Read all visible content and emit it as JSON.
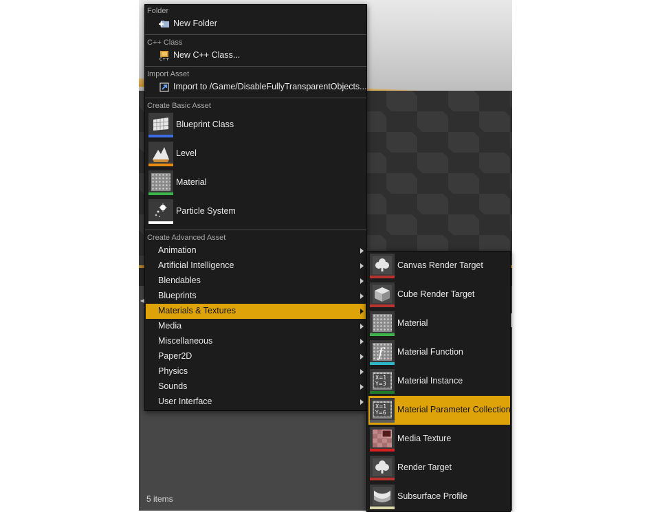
{
  "menu": {
    "sections": {
      "folder": "Folder",
      "cpp": "C++ Class",
      "import": "Import Asset",
      "basic": "Create Basic Asset",
      "advanced": "Create Advanced Asset"
    },
    "new_folder": "New Folder",
    "new_cpp_class": "New C++ Class...",
    "import_to": "Import to /Game/DisableFullyTransparentObjects...",
    "basic_assets": [
      {
        "label": "Blueprint Class",
        "color": "#3b6de0"
      },
      {
        "label": "Level",
        "color": "#e88a13"
      },
      {
        "label": "Material",
        "color": "#39b54a"
      },
      {
        "label": "Particle System",
        "color": "#ffffff"
      }
    ],
    "advanced_items": [
      "Animation",
      "Artificial Intelligence",
      "Blendables",
      "Blueprints",
      "Materials & Textures",
      "Media",
      "Miscellaneous",
      "Paper2D",
      "Physics",
      "Sounds",
      "User Interface"
    ],
    "active_item": "Materials & Textures"
  },
  "submenu": {
    "items": [
      {
        "label": "Canvas Render Target",
        "color": "#b8322e"
      },
      {
        "label": "Cube Render Target",
        "color": "#b8322e"
      },
      {
        "label": "Material",
        "color": "#39b54a"
      },
      {
        "label": "Material Function",
        "color": "#2fb5c8"
      },
      {
        "label": "Material Instance",
        "color": "#1f7a2a"
      },
      {
        "label": "Material Parameter Collection",
        "color": "#5a5a5a"
      },
      {
        "label": "Media Texture",
        "color": "#d32020"
      },
      {
        "label": "Render Target",
        "color": "#b8322e"
      },
      {
        "label": "Subsurface Profile",
        "color": "#d8d8a8"
      }
    ],
    "active_item": "Material Parameter Collection"
  },
  "content_browser": {
    "items_count": "5 items"
  },
  "colors": {
    "highlight": "#dea309",
    "menu_bg": "#1c1c1c"
  }
}
